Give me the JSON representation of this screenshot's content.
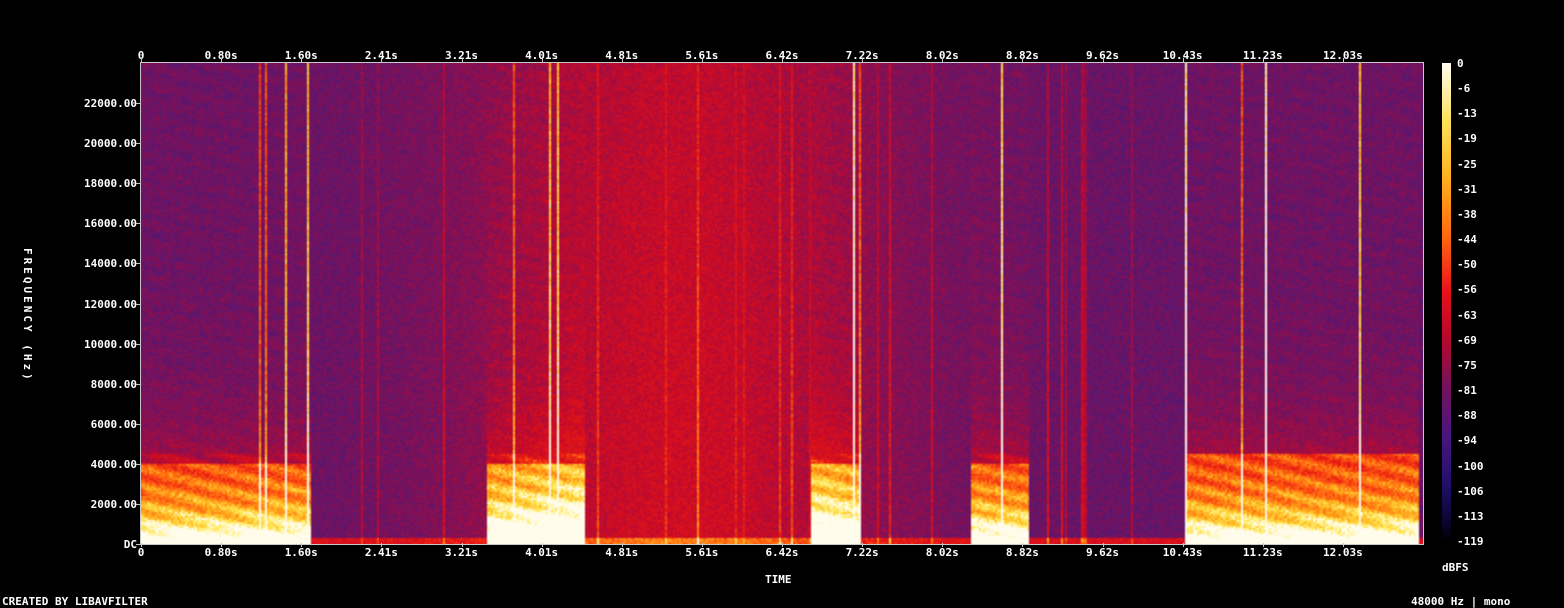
{
  "chart_data": {
    "type": "heatmap",
    "title": "",
    "xlabel": "TIME",
    "ylabel": "FREQUENCY (Hz)",
    "x_ticks": [
      "0",
      "0.80s",
      "1.60s",
      "2.41s",
      "3.21s",
      "4.01s",
      "4.81s",
      "5.61s",
      "6.42s",
      "7.22s",
      "8.02s",
      "8.82s",
      "9.62s",
      "10.43s",
      "11.23s",
      "12.03s"
    ],
    "y_ticks": [
      "DC",
      "2000.00",
      "4000.00",
      "6000.00",
      "8000.00",
      "10000.00",
      "12000.00",
      "14000.00",
      "16000.00",
      "18000.00",
      "20000.00",
      "22000.00"
    ],
    "xlim": [
      0,
      12.83
    ],
    "ylim": [
      0,
      24000
    ],
    "colorbar": {
      "label": "dBFS",
      "ticks": [
        "0",
        "-6",
        "-13",
        "-19",
        "-25",
        "-31",
        "-38",
        "-44",
        "-50",
        "-56",
        "-63",
        "-69",
        "-75",
        "-81",
        "-88",
        "-94",
        "-100",
        "-106",
        "-113",
        "-119"
      ],
      "range": [
        -119,
        0
      ]
    },
    "speech_segments": [
      {
        "start": 0.0,
        "end": 1.7,
        "peak_freq": 4000
      },
      {
        "start": 3.45,
        "end": 4.45,
        "peak_freq": 4000
      },
      {
        "start": 6.7,
        "end": 7.2,
        "peak_freq": 4000
      },
      {
        "start": 8.3,
        "end": 8.9,
        "peak_freq": 4000
      },
      {
        "start": 10.45,
        "end": 12.8,
        "peak_freq": 4500
      }
    ],
    "noise_band": {
      "start": 3.0,
      "end": 7.5,
      "center": 5.4,
      "level": "high"
    },
    "grid": false
  },
  "footer": {
    "left": "CREATED BY LIBAVFILTER",
    "right": "48000 Hz | mono"
  },
  "colors": {
    "background": "#000000",
    "low": "#3a1470",
    "mid": "#d80f1e",
    "high": "#ffe860"
  }
}
